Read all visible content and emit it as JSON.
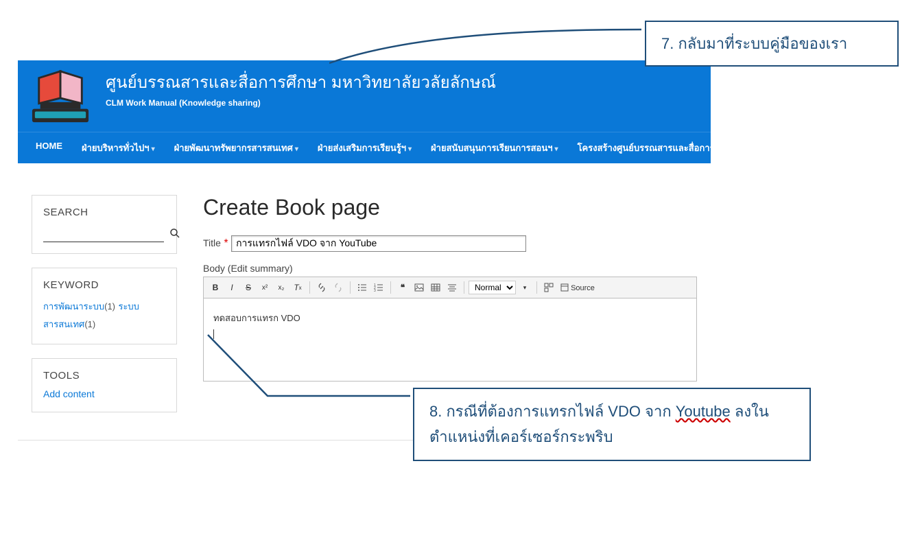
{
  "annotations": {
    "callout7": "7. กลับมาที่ระบบคู่มือของเรา",
    "callout8_pre": "8. กรณีที่ต้องการแทรกไฟล์ VDO จาก ",
    "callout8_word": "Youtube",
    "callout8_post": " ลงในตำแหน่งที่เคอร์เซอร์กระพริบ"
  },
  "header": {
    "title": "ศูนย์บรรณสารและสื่อการศึกษา มหาวิทยาลัยวลัยลักษณ์",
    "subtitle": "CLM Work Manual (Knowledge sharing)"
  },
  "nav": {
    "home": "HOME",
    "items": [
      "ฝ่ายบริหารทั่วไปฯ",
      "ฝ่ายพัฒนาทรัพยากรสารสนเทศ",
      "ฝ่ายส่งเสริมการเรียนรู้ฯ",
      "ฝ่ายสนับสนุนการเรียนการสอนฯ",
      "โครงสร้างศูนย์บรรณสารและสื่อการศึกษา"
    ]
  },
  "sidebar": {
    "search": {
      "title": "SEARCH",
      "value": ""
    },
    "keyword": {
      "title": "KEYWORD",
      "items": [
        {
          "label": "การพัฒนาระบบ",
          "count": "(1)"
        },
        {
          "label": "ระบบสารสนเทศ",
          "count": "(1)"
        }
      ]
    },
    "tools": {
      "title": "TOOLS",
      "link": "Add content"
    }
  },
  "main": {
    "page_title": "Create Book page",
    "title_label": "Title",
    "title_value": "การแทรกไฟล์ VDO จาก YouTube",
    "body_label": "Body (Edit summary)",
    "editor_text": "ทดสอบการแทรก VDO"
  },
  "toolbar": {
    "format_select": "Normal",
    "source": "Source"
  }
}
